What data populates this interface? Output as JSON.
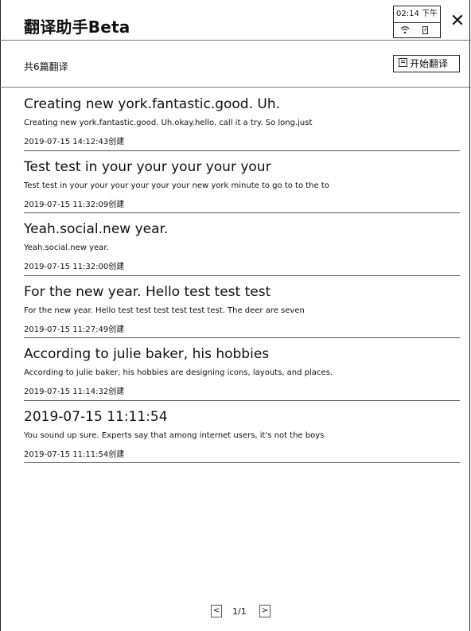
{
  "header": {
    "title": "翻译助手Beta",
    "close_icon": "close-icon"
  },
  "status": {
    "time": "02:14 下午",
    "wifi_icon": "wifi-icon",
    "battery_icon": "battery-icon"
  },
  "toolbar": {
    "count_text": "共6篇翻译",
    "start_label": "开始翻译",
    "start_icon": "document-icon"
  },
  "items": [
    {
      "title": "Creating new york.fantastic.good. Uh.",
      "snippet": "Creating new york.fantastic.good. Uh.okay.hello. call it a try. So long.just",
      "date": "2019-07-15 14:12:43创建"
    },
    {
      "title": "Test test in your your your your your",
      "snippet": "Test test in your your your your your your new york minute to go to to the to",
      "date": "2019-07-15 11:32:09创建"
    },
    {
      "title": "Yeah.social.new year.",
      "snippet": "Yeah.social.new year.",
      "date": "2019-07-15 11:32:00创建"
    },
    {
      "title": "For the new year. Hello test test test",
      "snippet": "For the new year. Hello test test test test test test. The deer are seven",
      "date": "2019-07-15 11:27:49创建"
    },
    {
      "title": "According to julie baker, his hobbies",
      "snippet": "According to julie baker, his hobbies are designing icons, layouts, and places.",
      "date": "2019-07-15 11:14:32创建"
    },
    {
      "title": "2019-07-15 11:11:54",
      "snippet": "You sound up sure. Experts say that among internet users, it's not the boys",
      "date": "2019-07-15 11:11:54创建"
    }
  ],
  "pagination": {
    "prev": "<",
    "page": "1/1",
    "next": ">"
  }
}
